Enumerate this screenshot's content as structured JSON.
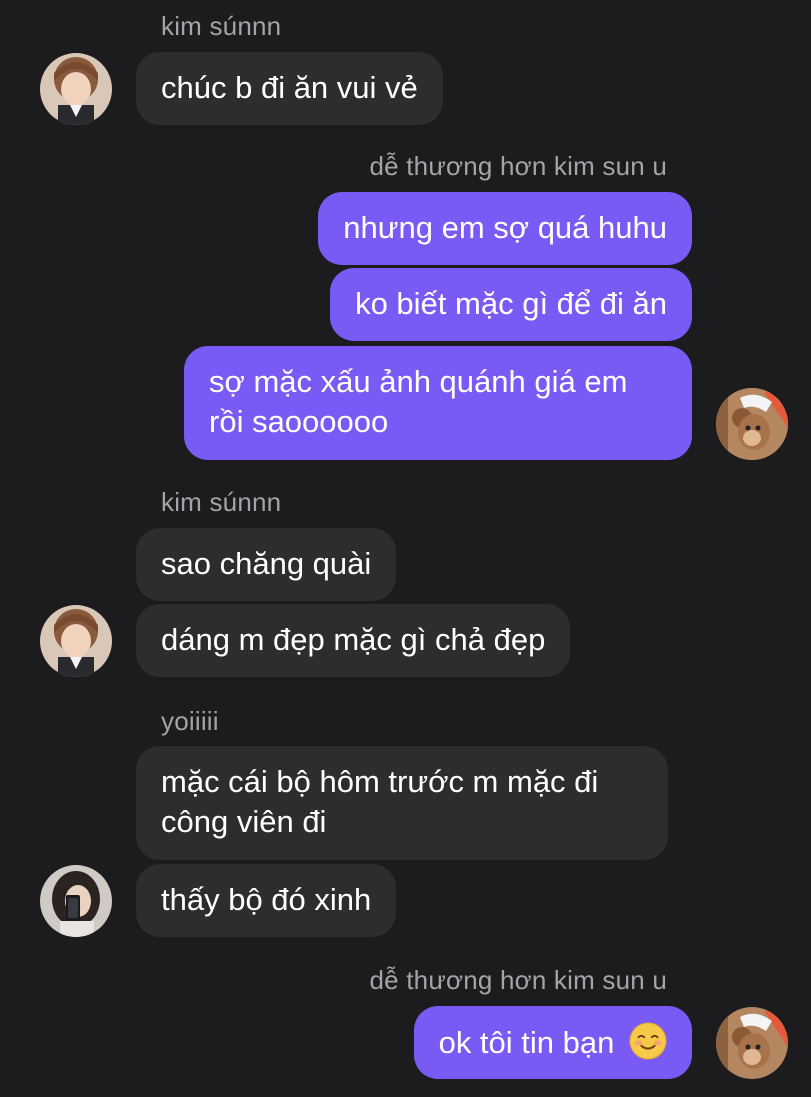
{
  "messages": {
    "g1": {
      "sender": "kim súnnn",
      "b1": "chúc b đi ăn vui vẻ"
    },
    "g2": {
      "sender": "dễ thương hơn kim sun u",
      "b1": "nhưng em sợ quá huhu",
      "b2": "ko biết mặc gì để đi ăn",
      "b3_line1": "sợ mặc xấu ảnh quánh giá em",
      "b3_line2": "rồi saoooooo"
    },
    "g3": {
      "sender": "kim súnnn",
      "b1": "sao chăng quài",
      "b2": "dáng m đẹp mặc gì chả đẹp"
    },
    "g4": {
      "sender": "yoiiiii",
      "b1_line1": "mặc cái bộ hôm trước m mặc đi",
      "b1_line2": "công viên đi",
      "b2": "thấy bộ đó xinh"
    },
    "g5": {
      "sender": "dễ thương hơn kim sun u",
      "b1": "ok tôi tin bạn"
    }
  },
  "icons": {
    "emoji": "smiling-face-with-smiling-eyes-emoji",
    "avatar_kim": "avatar-kim-sunnn",
    "avatar_me": "avatar-cartoon-mouse",
    "avatar_yoi": "avatar-yoiiiii"
  },
  "colors": {
    "background": "#1c1c1e",
    "incoming_bubble": "#2d2d30",
    "outgoing_bubble": "#7a5af5",
    "sender_text": "#a4a4a8",
    "message_text": "#ffffff"
  }
}
